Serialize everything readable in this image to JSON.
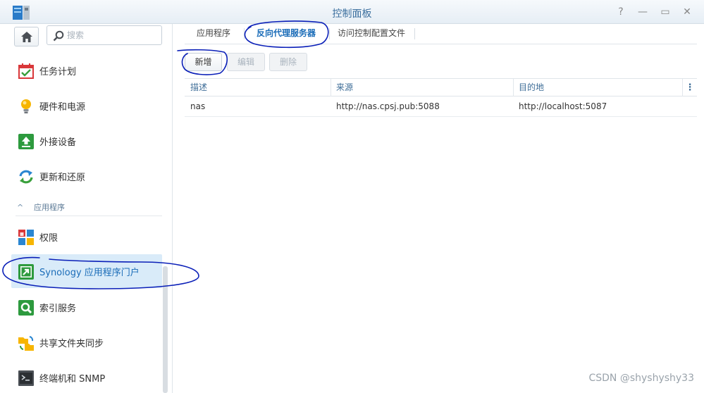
{
  "window": {
    "title": "控制面板",
    "buttons": {
      "help": "?",
      "minimize": "—",
      "maximize": "▭",
      "close": "✕"
    }
  },
  "sidebar": {
    "search_placeholder": "搜索",
    "items": [
      {
        "label": "任务计划",
        "icon": "calendar-check-icon"
      },
      {
        "label": "硬件和电源",
        "icon": "lightbulb-icon"
      },
      {
        "label": "外接设备",
        "icon": "upload-icon"
      },
      {
        "label": "更新和还原",
        "icon": "refresh-icon"
      }
    ],
    "section": {
      "label": "应用程序",
      "chevron": "^"
    },
    "app_items": [
      {
        "label": "权限",
        "icon": "permissions-icon"
      },
      {
        "label": "Synology 应用程序门户",
        "icon": "portal-icon",
        "active": true
      },
      {
        "label": "索引服务",
        "icon": "index-search-icon"
      },
      {
        "label": "共享文件夹同步",
        "icon": "folder-sync-icon"
      },
      {
        "label": "终端机和 SNMP",
        "icon": "terminal-icon"
      }
    ]
  },
  "tabs": [
    {
      "label": "应用程序"
    },
    {
      "label": "反向代理服务器",
      "active": true
    },
    {
      "label": "访问控制配置文件"
    }
  ],
  "toolbar": {
    "add": "新增",
    "edit": "编辑",
    "delete": "删除"
  },
  "grid": {
    "columns": [
      "描述",
      "来源",
      "目的地"
    ],
    "menu": "⋮",
    "rows": [
      {
        "description": "nas",
        "source": "http://nas.cpsj.pub:5088",
        "destination": "http://localhost:5087"
      }
    ]
  },
  "watermark": "CSDN @shyshyshy33",
  "colors": {
    "accent": "#1a6cb8",
    "active_bg": "#d9ebf9",
    "annotation": "#0a1fb8"
  }
}
